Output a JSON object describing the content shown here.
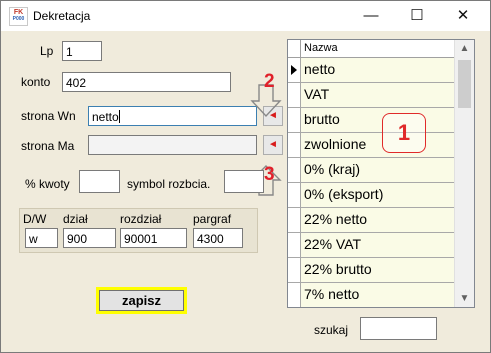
{
  "window": {
    "title": "Dekretacja",
    "app_icon_text": "FK",
    "app_icon_subtext": "P000",
    "minimize_glyph": "—",
    "maximize_glyph": "☐",
    "close_glyph": "✕"
  },
  "form": {
    "lp_label": "Lp",
    "lp_value": "1",
    "konto_label": "konto",
    "konto_value": "402",
    "strona_wn_label": "strona Wn",
    "strona_wn_value": "netto",
    "strona_ma_label": "strona Ma",
    "strona_ma_value": "",
    "procent_kwoty_label": "% kwoty",
    "procent_kwoty_value": "",
    "symbol_rozbicia_label": "symbol rozbcia.",
    "symbol_rozbicia_value": "",
    "dw_label": "D/W",
    "dw_value": "w",
    "dzial_label": "dział",
    "dzial_value": "900",
    "rozdzial_label": "rozdział",
    "rozdzial_value": "90001",
    "paragraf_label": "pargraf",
    "paragraf_value": "4300",
    "assign_wn_glyph": "◄",
    "assign_ma_glyph": "◄",
    "save_label": "zapisz",
    "szukaj_label": "szukaj",
    "szukaj_value": ""
  },
  "list": {
    "header": "Nazwa",
    "items": [
      "netto",
      "VAT",
      "brutto",
      "zwolnione",
      "0% (kraj)",
      "0% (eksport)",
      "22% netto",
      "22% VAT",
      "22% brutto",
      "7% netto"
    ],
    "selected_index": 0
  },
  "annotations": {
    "marker1": "1",
    "marker2": "2",
    "marker3": "3",
    "color": "#e02a2a"
  },
  "scrollbar": {
    "up_glyph": "▲",
    "down_glyph": "▼"
  }
}
